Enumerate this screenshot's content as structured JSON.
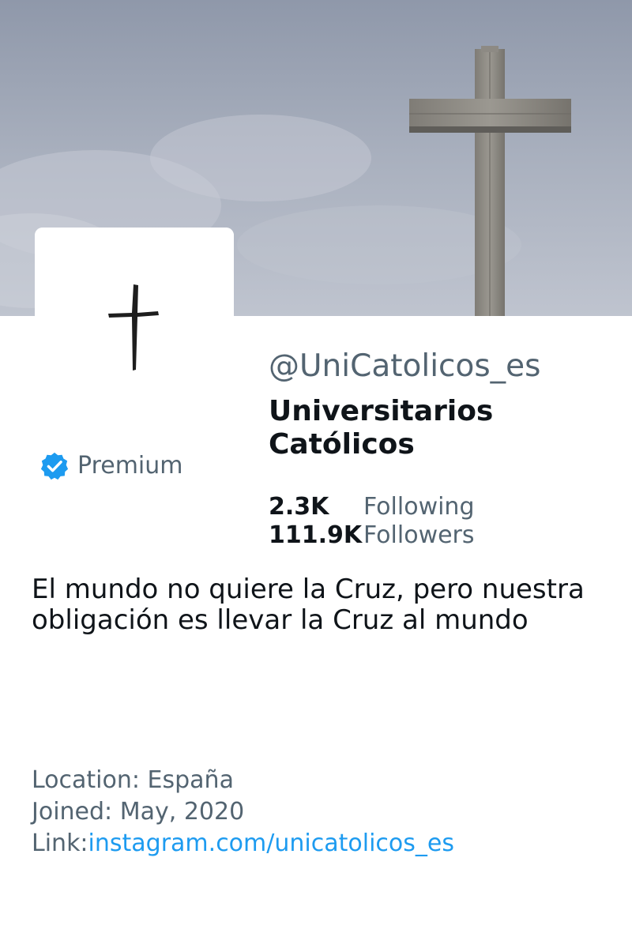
{
  "profile": {
    "handle": "@UniCatolicos_es",
    "display_name": "Universitarios Católicos",
    "badge": {
      "label": "Premium",
      "icon": "verified-badge-icon",
      "color": "#1d9bf0"
    },
    "stats": {
      "following": {
        "value": "2.3K",
        "label": "Following"
      },
      "followers": {
        "value": "111.9K",
        "label": "Followers"
      }
    },
    "bio": "El mundo no quiere la Cruz, pero nuestra obligación es llevar la Cruz al mundo",
    "meta": {
      "location_label": "Location:",
      "location": "España",
      "joined_label": "Joined:",
      "joined": "May, 2020",
      "link_label": "Link:",
      "link": "instagram.com/unicatolicos_es"
    }
  },
  "colors": {
    "text_primary": "#0f1419",
    "text_secondary": "#536471",
    "link": "#1d9bf0",
    "banner_sky": "#aab2c1"
  }
}
